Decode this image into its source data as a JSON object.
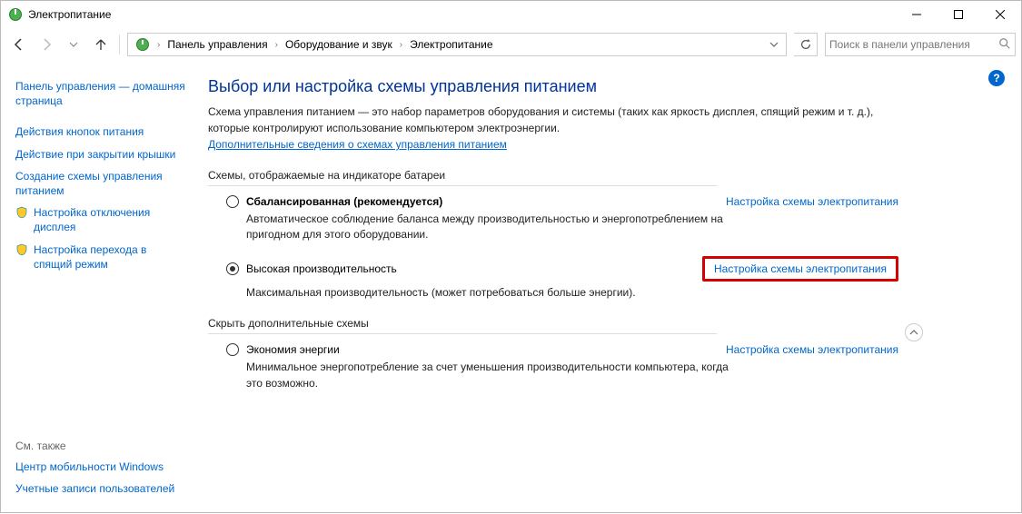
{
  "window": {
    "title": "Электропитание"
  },
  "breadcrumb": {
    "items": [
      "Панель управления",
      "Оборудование и звук",
      "Электропитание"
    ]
  },
  "search": {
    "placeholder": "Поиск в панели управления"
  },
  "sidebar": {
    "items": [
      {
        "label": "Панель управления — домашняя страница"
      },
      {
        "label": "Действия кнопок питания"
      },
      {
        "label": "Действие при закрытии крышки"
      },
      {
        "label": "Создание схемы управления питанием"
      },
      {
        "label": "Настройка отключения дисплея"
      },
      {
        "label": "Настройка перехода в спящий режим"
      }
    ],
    "see_also_heading": "См. также",
    "see_also": [
      {
        "label": "Центр мобильности Windows"
      },
      {
        "label": "Учетные записи пользователей"
      }
    ]
  },
  "main": {
    "heading": "Выбор или настройка схемы управления питанием",
    "description": "Схема управления питанием — это набор параметров оборудования и системы (таких как яркость дисплея, спящий режим и т. д.), которые контролируют использование компьютером электроэнергии.",
    "info_link": "Дополнительные сведения о схемах управления питанием",
    "group1_title": "Схемы, отображаемые на индикаторе батареи",
    "group2_title": "Скрыть дополнительные схемы",
    "plans": {
      "balanced": {
        "name": "Сбалансированная (рекомендуется)",
        "desc": "Автоматическое соблюдение баланса между производительностью и энергопотреблением на пригодном для этого оборудовании.",
        "settings": "Настройка схемы электропитания"
      },
      "high_perf": {
        "name": "Высокая производительность",
        "desc": "Максимальная производительность (может потребоваться больше энергии).",
        "settings": "Настройка схемы электропитания"
      },
      "power_saver": {
        "name": "Экономия энергии",
        "desc": "Минимальное энергопотребление за счет уменьшения производительности компьютера, когда это возможно.",
        "settings": "Настройка схемы электропитания"
      }
    }
  }
}
